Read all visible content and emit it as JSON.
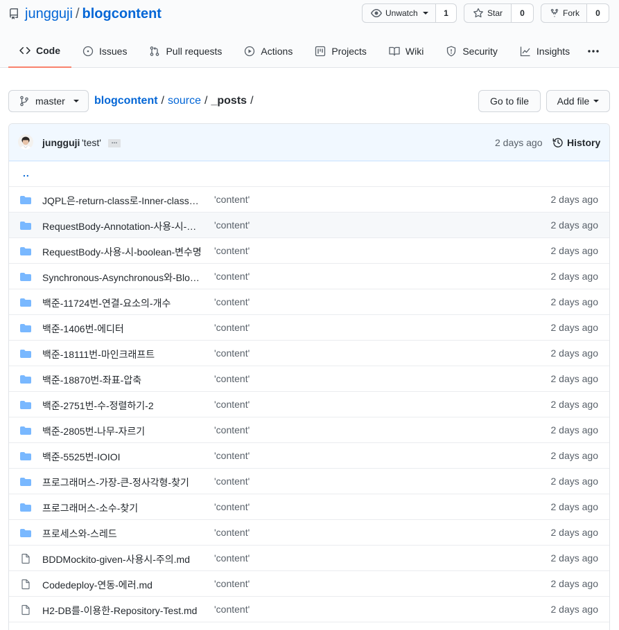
{
  "repo": {
    "owner": "jungguji",
    "separator": "/",
    "name": "blogcontent"
  },
  "actions": {
    "watch": {
      "label": "Unwatch",
      "count": "1"
    },
    "star": {
      "label": "Star",
      "count": "0"
    },
    "fork": {
      "label": "Fork",
      "count": "0"
    }
  },
  "tabs": [
    {
      "label": "Code",
      "icon": "code-icon",
      "selected": true
    },
    {
      "label": "Issues",
      "icon": "issue-icon"
    },
    {
      "label": "Pull requests",
      "icon": "pull-request-icon"
    },
    {
      "label": "Actions",
      "icon": "play-icon"
    },
    {
      "label": "Projects",
      "icon": "project-icon"
    },
    {
      "label": "Wiki",
      "icon": "book-icon"
    },
    {
      "label": "Security",
      "icon": "shield-icon"
    },
    {
      "label": "Insights",
      "icon": "graph-icon"
    }
  ],
  "branch": {
    "name": "master"
  },
  "breadcrumb": {
    "root": "blogcontent",
    "segment": "source",
    "current": "_posts",
    "separator": "/"
  },
  "buttons": {
    "go_to_file": "Go to file",
    "add_file": "Add file"
  },
  "commit": {
    "author": "jungguji",
    "message": "'test'",
    "ellipsis": "…",
    "age": "2 days ago",
    "history": "History"
  },
  "up_link": "..",
  "files": [
    {
      "type": "dir",
      "name": "JQPL은-return-class로-Inner-class를-사용할-때",
      "message": "'content'",
      "age": "2 days ago"
    },
    {
      "type": "dir",
      "name": "RequestBody-Annotation-사용-시-주의점",
      "message": "'content'",
      "age": "2 days ago"
    },
    {
      "type": "dir",
      "name": "RequestBody-사용-시-boolean-변수명",
      "message": "'content'",
      "age": "2 days ago"
    },
    {
      "type": "dir",
      "name": "Synchronous-Asynchronous와-Blocking-NonBlocking",
      "message": "'content'",
      "age": "2 days ago"
    },
    {
      "type": "dir",
      "name": "백준-11724번-연결-요소의-개수",
      "message": "'content'",
      "age": "2 days ago"
    },
    {
      "type": "dir",
      "name": "백준-1406번-에디터",
      "message": "'content'",
      "age": "2 days ago"
    },
    {
      "type": "dir",
      "name": "백준-18111번-마인크래프트",
      "message": "'content'",
      "age": "2 days ago"
    },
    {
      "type": "dir",
      "name": "백준-18870번-좌표-압축",
      "message": "'content'",
      "age": "2 days ago"
    },
    {
      "type": "dir",
      "name": "백준-2751번-수-정렬하기-2",
      "message": "'content'",
      "age": "2 days ago"
    },
    {
      "type": "dir",
      "name": "백준-2805번-나무-자르기",
      "message": "'content'",
      "age": "2 days ago"
    },
    {
      "type": "dir",
      "name": "백준-5525번-IOIOI",
      "message": "'content'",
      "age": "2 days ago"
    },
    {
      "type": "dir",
      "name": "프로그래머스-가장-큰-정사각형-찾기",
      "message": "'content'",
      "age": "2 days ago"
    },
    {
      "type": "dir",
      "name": "프로그래머스-소수-찾기",
      "message": "'content'",
      "age": "2 days ago"
    },
    {
      "type": "dir",
      "name": "프로세스와-스레드",
      "message": "'content'",
      "age": "2 days ago"
    },
    {
      "type": "file",
      "name": "BDDMockito-given-사용시-주의.md",
      "message": "'content'",
      "age": "2 days ago"
    },
    {
      "type": "file",
      "name": "Codedeploy-연동-에러.md",
      "message": "'content'",
      "age": "2 days ago"
    },
    {
      "type": "file",
      "name": "H2-DB를-이용한-Repository-Test.md",
      "message": "'content'",
      "age": "2 days ago"
    }
  ],
  "colors": {
    "link": "#0366d6",
    "folder": "#79b8ff",
    "tab_underline": "#f9826c",
    "commit_bg": "#f1f8ff"
  }
}
